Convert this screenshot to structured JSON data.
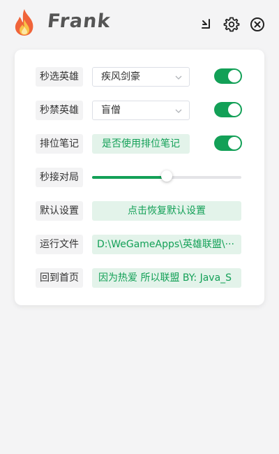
{
  "app": {
    "title": "Frank"
  },
  "icons": {
    "logo": "flame-icon",
    "minimize": "minimize-icon",
    "settings": "gear-icon",
    "close": "close-circle-icon",
    "select_arrow": "chevron-down-icon"
  },
  "colors": {
    "accent": "#13a057",
    "accent_bg": "#e3f3ea",
    "label_bg": "#f3f3f4",
    "page_bg": "#f4f4f5"
  },
  "settings": {
    "pick_hero": {
      "label": "秒选英雄",
      "value": "疾风剑豪",
      "enabled": true
    },
    "ban_hero": {
      "label": "秒禁英雄",
      "value": "盲僧",
      "enabled": true
    },
    "rank_notes": {
      "label": "排位笔记",
      "text": "是否使用排位笔记",
      "enabled": true
    },
    "auto_accept": {
      "label": "秒接对局",
      "level": 0.5
    },
    "defaults": {
      "label": "默认设置",
      "button": "点击恢复默认设置"
    },
    "run_file": {
      "label": "运行文件",
      "path": "D:\\WeGameApps\\英雄联盟\\···"
    },
    "home": {
      "label": "回到首页",
      "text": "因为热爱 所以联盟 BY: Java_S"
    }
  }
}
